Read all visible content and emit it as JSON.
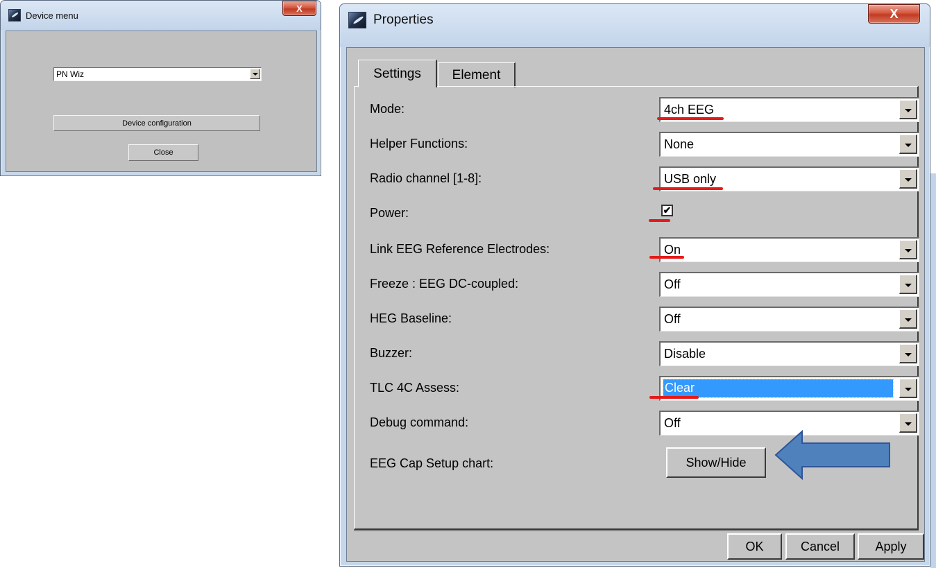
{
  "device_menu": {
    "title": "Device menu",
    "device_selected": "PN Wiz",
    "config_button": "Device configuration",
    "close_button": "Close"
  },
  "properties": {
    "title": "Properties",
    "tabs": [
      {
        "label": "Settings",
        "active": true
      },
      {
        "label": "Element",
        "active": false
      }
    ],
    "rows": [
      {
        "label": "Mode:",
        "value": "4ch EEG"
      },
      {
        "label": "Helper Functions:",
        "value": "None"
      },
      {
        "label": "Radio channel [1-8]:",
        "value": "USB only"
      },
      {
        "label": "Power:",
        "checked": true
      },
      {
        "label": "Link EEG Reference Electrodes:",
        "value": "On"
      },
      {
        "label": "Freeze : EEG DC-coupled:",
        "value": "Off"
      },
      {
        "label": "HEG Baseline:",
        "value": "Off"
      },
      {
        "label": "Buzzer:",
        "value": "Disable"
      },
      {
        "label": "TLC 4C Assess:",
        "value": "Clear"
      },
      {
        "label": "Debug command:",
        "value": "Off"
      },
      {
        "label": "EEG Cap Setup chart:",
        "button": "Show/Hide"
      }
    ],
    "footer": {
      "ok": "OK",
      "cancel": "Cancel",
      "apply": "Apply"
    },
    "close_glyph": "X"
  },
  "colors": {
    "annotation_underline": "#e41a1a",
    "annotation_arrow": "#4f81bd",
    "selection": "#3399ff"
  }
}
